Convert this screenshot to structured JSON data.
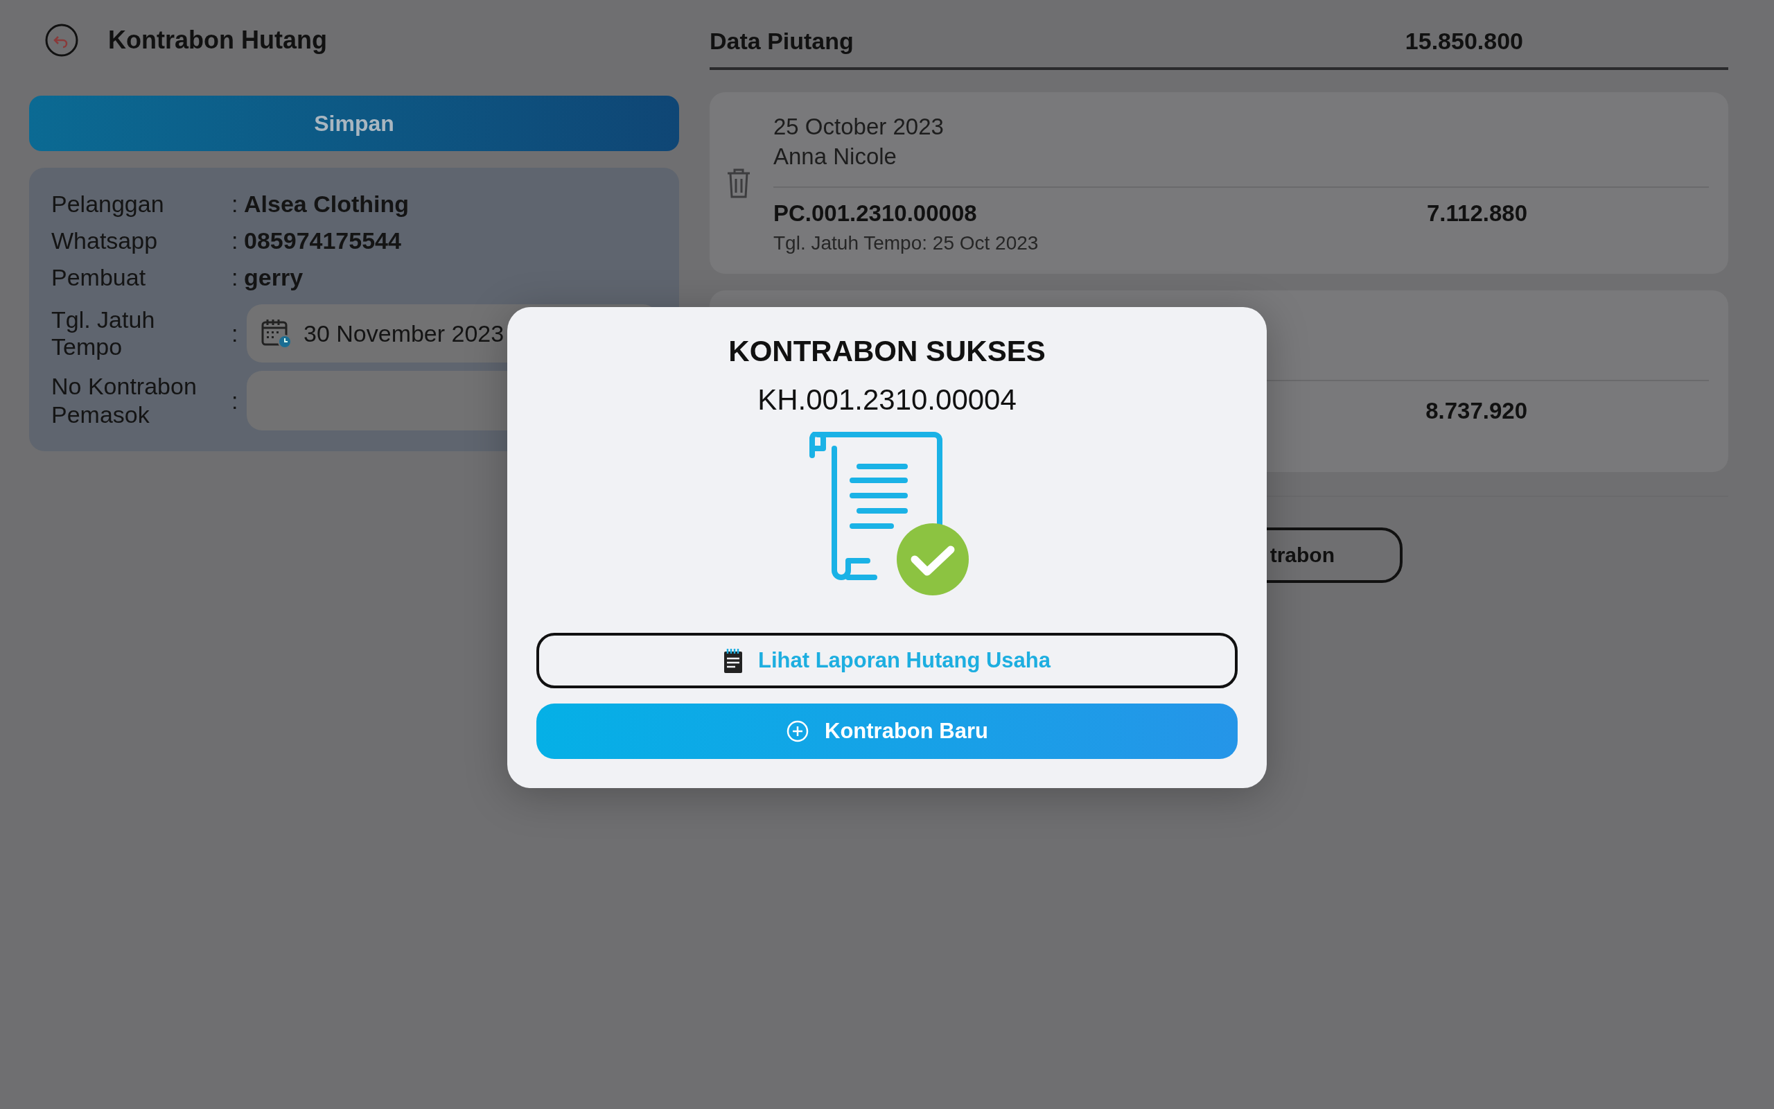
{
  "header": {
    "title": "Kontrabon Hutang"
  },
  "save_button": {
    "label": "Simpan"
  },
  "customer_info": {
    "rows": [
      {
        "label": "Pelanggan",
        "colon": ":",
        "value": "Alsea Clothing"
      },
      {
        "label": "Whatsapp",
        "colon": ":",
        "value": "085974175544"
      },
      {
        "label": "Pembuat",
        "colon": ":",
        "value": "gerry"
      }
    ],
    "due_date": {
      "label": "Tgl. Jatuh Tempo",
      "colon": ":",
      "value": "30 November 2023"
    },
    "supplier_contract_no": {
      "label": "No Kontrabon Pemasok",
      "colon": ":"
    }
  },
  "receivables": {
    "title": "Data Piutang",
    "total": "15.850.800",
    "items": [
      {
        "date": "25 October 2023",
        "customer": "Anna Nicole",
        "number": "PC.001.2310.00008",
        "due": "Tgl. Jatuh Tempo: 25 Oct 2023",
        "amount": "7.112.880"
      },
      {
        "amount": "8.737.920"
      }
    ],
    "create_button": {
      "label": "trabon"
    }
  },
  "dialog": {
    "title": "KONTRABON SUKSES",
    "number": "KH.001.2310.00004",
    "buttons": [
      {
        "kind": "outline",
        "label": "Lihat Laporan Hutang Usaha"
      },
      {
        "kind": "primary",
        "label": "Kontrabon Baru"
      }
    ]
  }
}
